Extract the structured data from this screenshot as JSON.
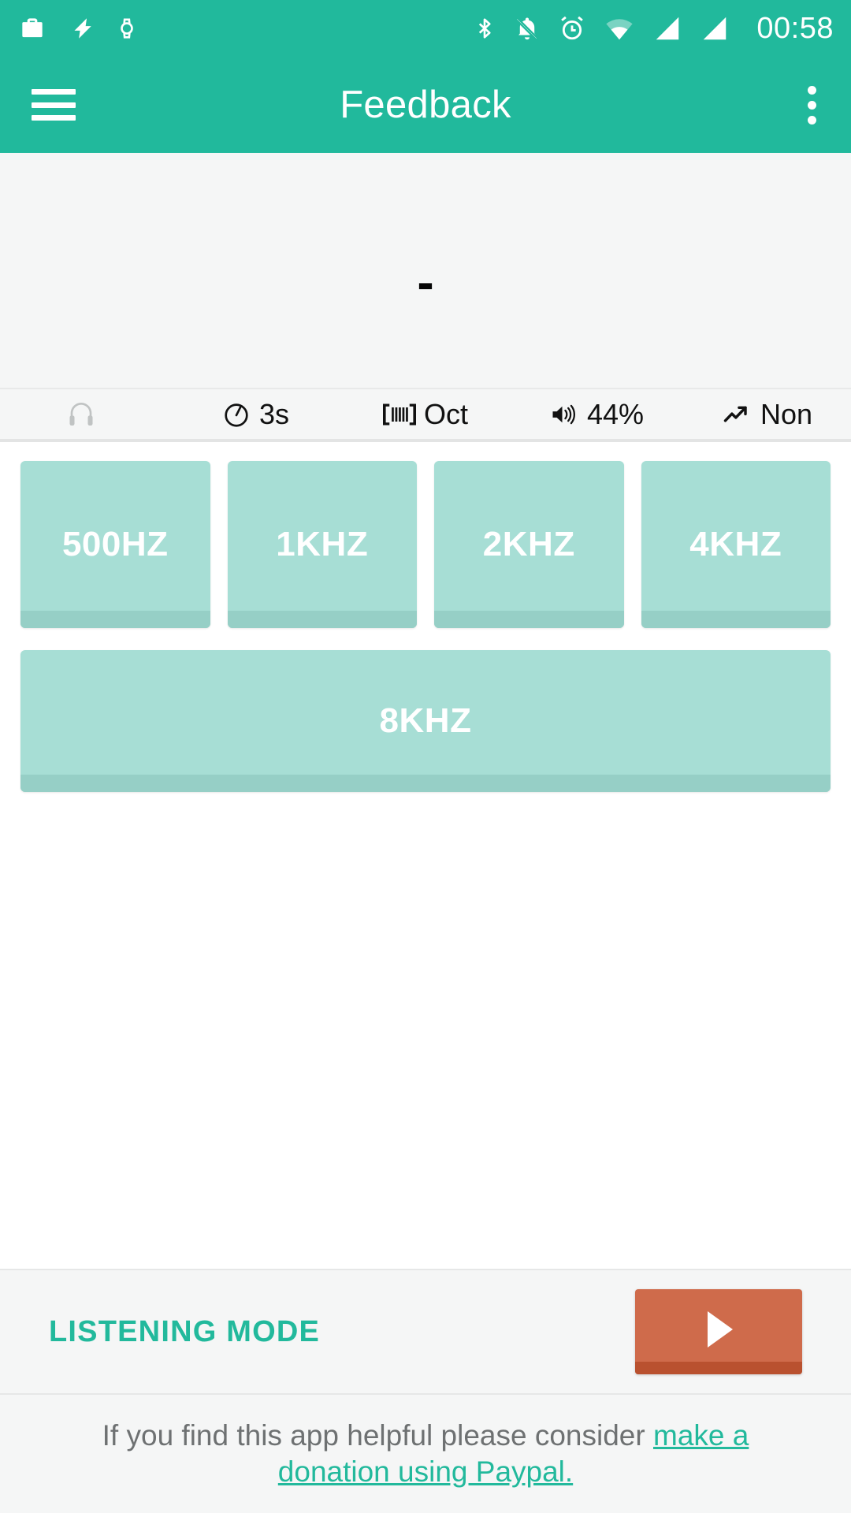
{
  "status_bar": {
    "left_icons": [
      {
        "name": "work-profile-briefcase-icon",
        "label": "work profile"
      },
      {
        "name": "flash-bolt-icon",
        "label": "charging"
      },
      {
        "name": "smartwatch-icon",
        "label": "watch connected"
      }
    ],
    "right_icons": [
      {
        "name": "bluetooth-icon",
        "label": "bluetooth"
      },
      {
        "name": "bell-muted-icon",
        "label": "silent"
      },
      {
        "name": "alarm-clock-icon",
        "label": "alarm set"
      },
      {
        "name": "wifi-icon",
        "label": "wifi"
      },
      {
        "name": "cellular-signal-icon-1",
        "label": "sim 1 signal"
      },
      {
        "name": "cellular-signal-icon-2",
        "label": "sim 2 signal"
      }
    ],
    "clock": "00:58"
  },
  "app_bar": {
    "menu_icon": "hamburger-menu-icon",
    "title": "Feedback",
    "overflow_icon": "overflow-menu-icon"
  },
  "display": {
    "value": "-"
  },
  "info_row": {
    "items": [
      {
        "icon": "headphones-icon",
        "label": "",
        "dim": true
      },
      {
        "icon": "timer-icon",
        "label": "3s",
        "dim": false
      },
      {
        "icon": "spectrum-bars-icon",
        "label": "Oct",
        "dim": false
      },
      {
        "icon": "volume-icon",
        "label": "44%",
        "dim": false
      },
      {
        "icon": "trending-up-icon",
        "label": "Non",
        "dim": false
      }
    ]
  },
  "frequency_buttons": {
    "row1": [
      {
        "label": "500HZ"
      },
      {
        "label": "1KHZ"
      },
      {
        "label": "2KHZ"
      },
      {
        "label": "4KHZ"
      }
    ],
    "row2": [
      {
        "label": "8KHZ"
      }
    ]
  },
  "action_bar": {
    "mode_label": "LISTENING MODE",
    "play_button_icon": "play-icon"
  },
  "footer": {
    "text_before": "If you find this app helpful please consider ",
    "link_text": "make a donation using Paypal."
  },
  "colors": {
    "teal": "#21b99c",
    "button_fill": "#a7ded5",
    "button_shadow": "#96cfc6",
    "play_orange": "#cf6b4b",
    "play_orange_shadow": "#b9512f",
    "surface": "#f5f6f6",
    "link": "#22b99c"
  }
}
